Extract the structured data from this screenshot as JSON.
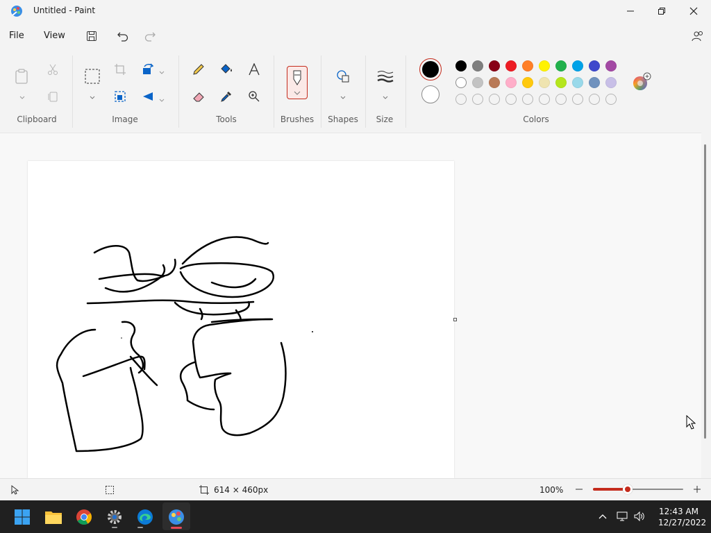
{
  "window": {
    "title": "Untitled - Paint"
  },
  "menu": {
    "file": "File",
    "view": "View"
  },
  "ribbon": {
    "groups": {
      "clipboard": "Clipboard",
      "image": "Image",
      "tools": "Tools",
      "brushes": "Brushes",
      "shapes": "Shapes",
      "size": "Size",
      "colors": "Colors"
    },
    "palette_row1": [
      "#000000",
      "#7f7f7f",
      "#880015",
      "#ed1c24",
      "#ff7f27",
      "#fff200",
      "#22b14c",
      "#00a2e8",
      "#3f48cc",
      "#a349a4"
    ],
    "palette_row2": [
      "#ffffff",
      "#c3c3c3",
      "#b97a57",
      "#ffaec9",
      "#ffc90e",
      "#efe4b0",
      "#b5e61d",
      "#99d9ea",
      "#7092be",
      "#c8bfe7"
    ],
    "primary_color": "#000000",
    "secondary_color": "#ffffff",
    "accent_color": "#c42b1c"
  },
  "status": {
    "canvas_size": "614 × 460px",
    "zoom": "100%",
    "zoom_fraction": 0.5
  },
  "taskbar": {
    "time": "12:43 AM",
    "date": "12/27/2022"
  }
}
